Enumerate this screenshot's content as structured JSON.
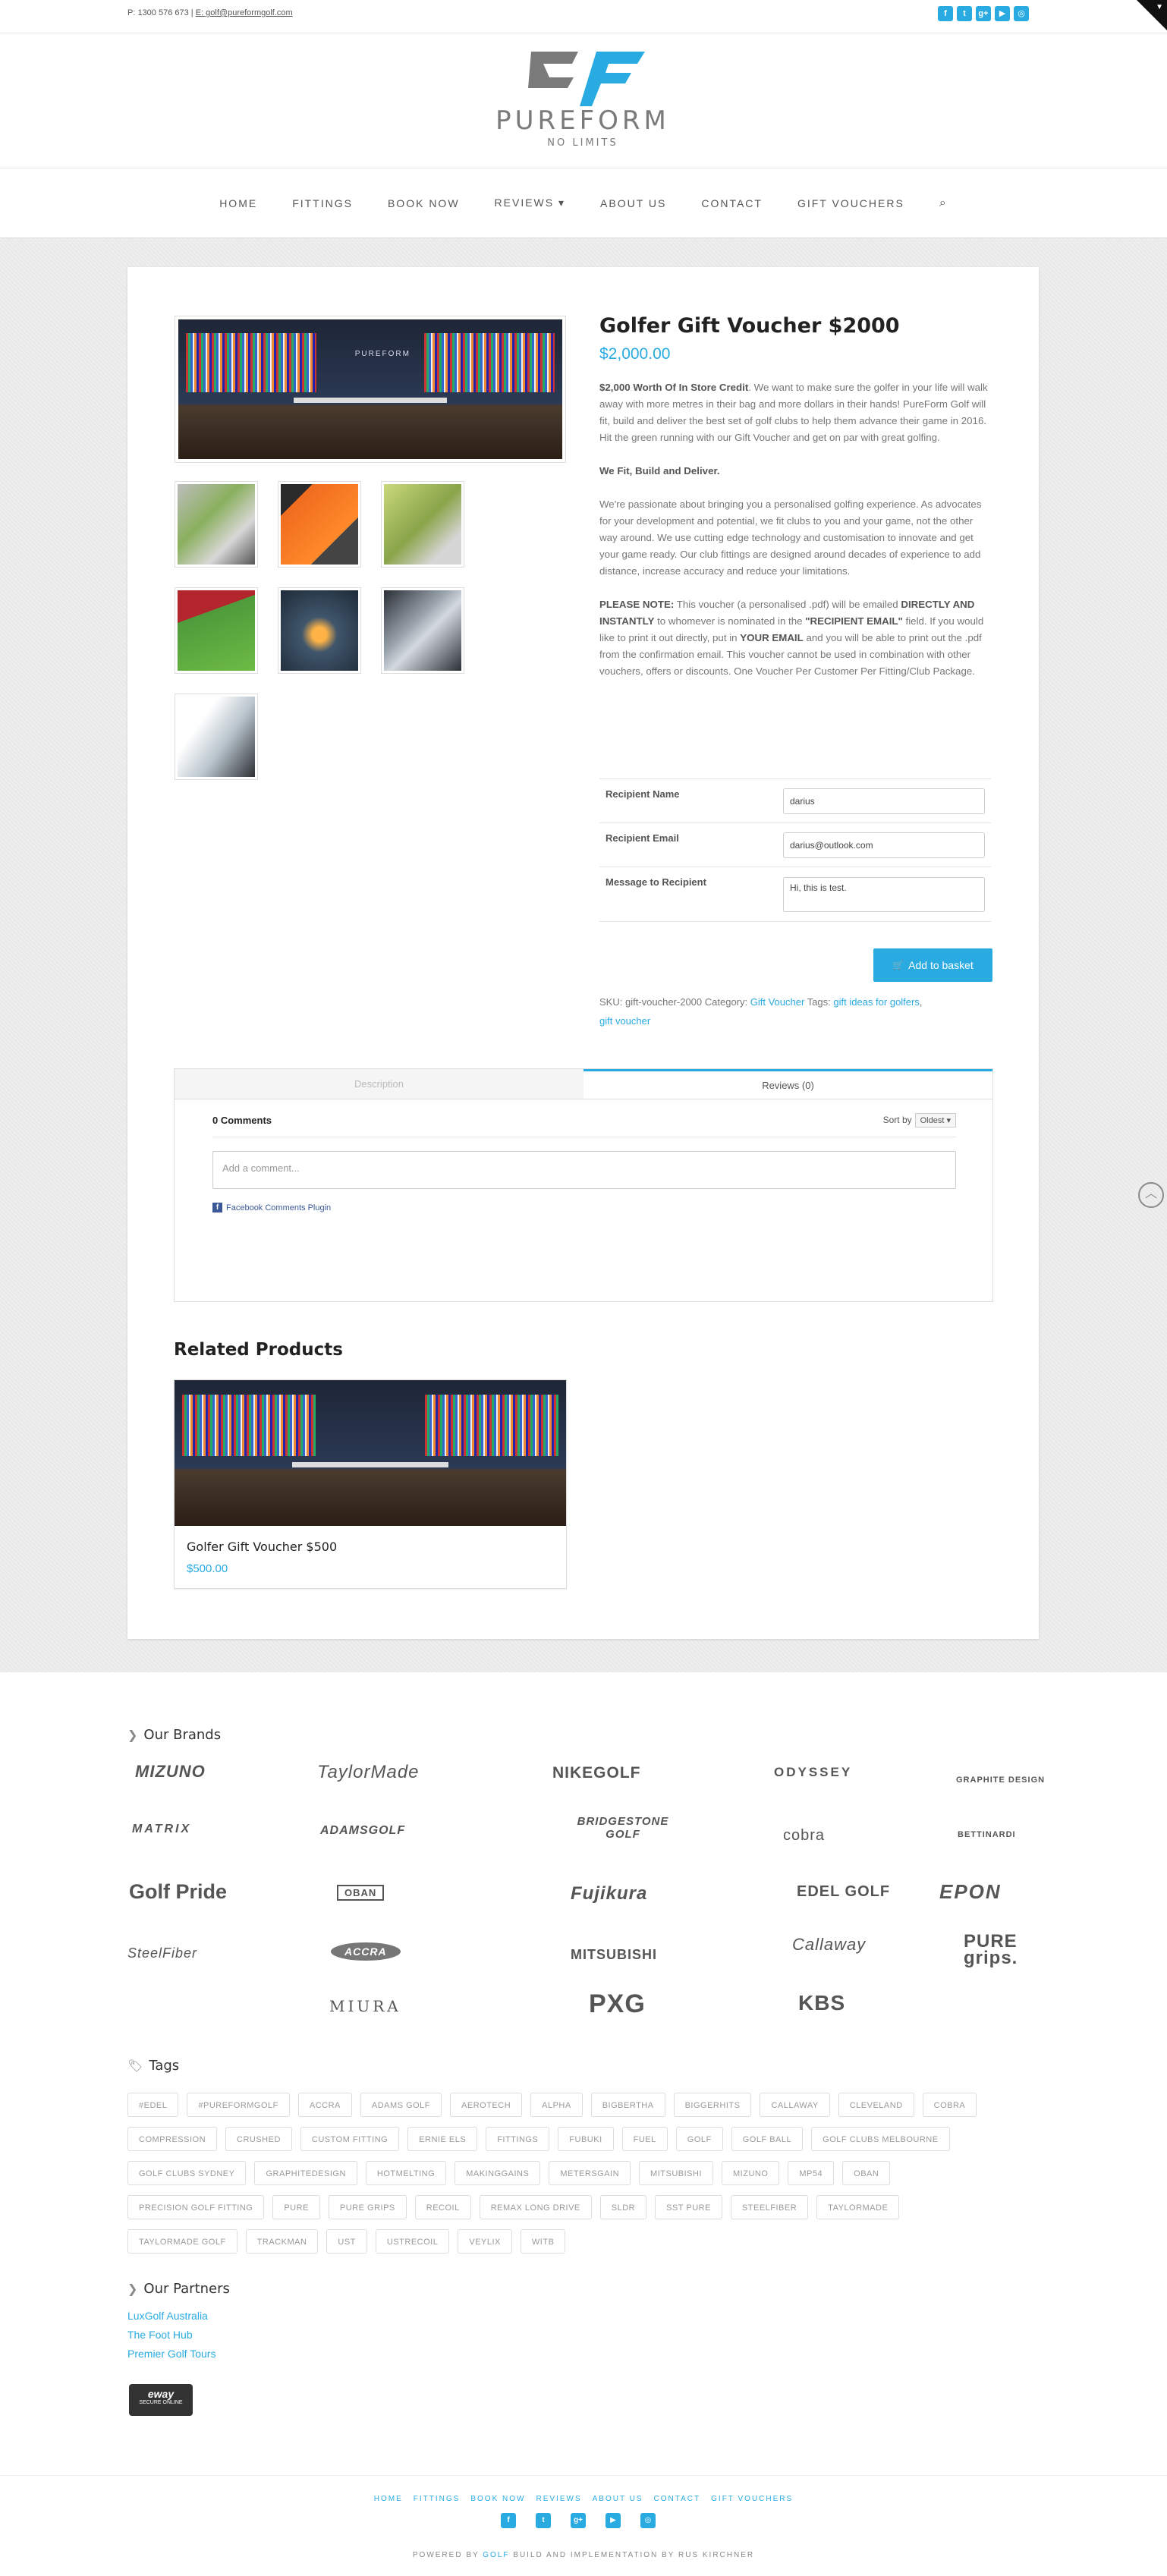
{
  "topbar": {
    "phone_label": "P: 1300 576 673",
    "separator": " | ",
    "email_label": "E: golf@pureformgolf.com",
    "social_icons": [
      "facebook-icon",
      "twitter-icon",
      "google-plus-icon",
      "youtube-icon",
      "instagram-icon"
    ],
    "social_glyphs": [
      "f",
      "t",
      "g+",
      "▶",
      "◎"
    ]
  },
  "logo": {
    "wordmark": "PUREFORM",
    "tagline": "NO LIMITS"
  },
  "nav": {
    "items": [
      "HOME",
      "FITTINGS",
      "BOOK NOW",
      "REVIEWS ▾",
      "ABOUT US",
      "CONTACT",
      "GIFT VOUCHERS"
    ],
    "search_glyph": "⌕"
  },
  "product": {
    "title": "Golfer Gift Voucher $2000",
    "price": "$2,000.00",
    "image_brand": "PUREFORM",
    "desc_p1_bold": "$2,000 Worth Of In Store Credit",
    "desc_p1_rest": ". We want to make sure the golfer in your life will walk away with more metres in their bag and more dollars in their hands! PureForm Golf will fit, build and deliver the best set of golf clubs to help them advance their game in 2016. Hit the green running with our Gift Voucher and get on par with great golfing.",
    "desc_p2": "We Fit, Build and Deliver.",
    "desc_p3": "We're passionate about bringing you a personalised golfing experience. As advocates for your development and potential, we fit clubs to you and your game, not the other way around. We use cutting edge technology and customisation to innovate and get your game ready. Our club fittings are designed around decades of experience to add distance, increase accuracy and reduce your limitations.",
    "note_label": "PLEASE NOTE:",
    "note_a": " This voucher (a personalised .pdf) will be emailed ",
    "note_b": "DIRECTLY AND INSTANTLY",
    "note_c": " to whomever is nominated in the ",
    "note_d": "\"RECIPIENT EMAIL\"",
    "note_e": " field.  If you would like to print it out directly, put in ",
    "note_f": "YOUR EMAIL",
    "note_g": " and you will be able to print out the .pdf from the confirmation email. This voucher cannot be used in combination with other vouchers, offers or discounts. One Voucher Per Customer Per Fitting/Club Package."
  },
  "form": {
    "recipient_name_label": "Recipient Name",
    "recipient_name_value": "darius",
    "recipient_email_label": "Recipient Email",
    "recipient_email_value": "darius@outlook.com",
    "message_label": "Message to Recipient",
    "message_value": "Hi, this is test.",
    "add_to_basket": "Add to basket",
    "basket_glyph": "🛒"
  },
  "meta": {
    "sku_label": "SKU:",
    "sku": "gift-voucher-2000",
    "category_label": "Category:",
    "category": "Gift Voucher",
    "tags_label": "Tags:",
    "tag1": "gift ideas for golfers",
    "tag_sep": ",",
    "tag2": "gift voucher"
  },
  "tabs": {
    "description": "Description",
    "reviews": "Reviews (0)"
  },
  "comments": {
    "count": "0 Comments",
    "sort_label": "Sort by",
    "sort_value": "Oldest ▾",
    "placeholder": "Add a comment...",
    "plugin_label": "Facebook Comments Plugin"
  },
  "related": {
    "heading": "Related Products",
    "items": [
      {
        "title": "Golfer Gift Voucher $500",
        "price": "$500.00"
      }
    ]
  },
  "brands": {
    "heading": "Our Brands",
    "logos": [
      "MIZUNO",
      "TaylorMade",
      "NIKEGOLF",
      "ODYSSEY",
      "GRAPHITE DESIGN",
      "MATRIX",
      "ADAMSGOLF",
      "BRIDGESTONE GOLF",
      "cobra",
      "BETTINARDI",
      "Golf Pride",
      "OBAN",
      "Fujikura",
      "EDEL GOLF",
      "EPON",
      "SteelFiber",
      "ACCRA",
      "MITSUBISHI",
      "Callaway",
      "PURE grips.",
      "MIURA",
      "PXG",
      "KBS"
    ]
  },
  "tags_section": {
    "heading": "Tags",
    "tags": [
      "#EDEL",
      "#PUREFORMGOLF",
      "ACCRA",
      "ADAMS GOLF",
      "AEROTECH",
      "ALPHA",
      "BIGBERTHA",
      "BIGGERHITS",
      "CALLAWAY",
      "CLEVELAND",
      "COBRA",
      "COMPRESSION",
      "CRUSHED",
      "CUSTOM FITTING",
      "ERNIE ELS",
      "FITTINGS",
      "FUBUKI",
      "FUEL",
      "GOLF",
      "GOLF BALL",
      "GOLF CLUBS MELBOURNE",
      "GOLF CLUBS SYDNEY",
      "GRAPHITEDESIGN",
      "HOTMELTING",
      "MAKINGGAINS",
      "METERSGAIN",
      "MITSUBISHI",
      "MIZUNO",
      "MP54",
      "OBAN",
      "PRECISION GOLF FITTING",
      "PURE",
      "PURE GRIPS",
      "RECOIL",
      "REMAX LONG DRIVE",
      "SLDR",
      "SST PURE",
      "STEELFIBER",
      "TAYLORMADE",
      "TAYLORMADE GOLF",
      "TRACKMAN",
      "UST",
      "USTRECOIL",
      "VEYLIX",
      "WITB"
    ]
  },
  "partners": {
    "heading": "Our Partners",
    "links": [
      "LuxGolf Australia",
      "The Foot Hub",
      "Premier Golf Tours"
    ],
    "eway_label": "eway",
    "eway_sub": "SECURE ONLINE"
  },
  "footer": {
    "nav": [
      "HOME",
      "FITTINGS",
      "BOOK NOW",
      "REVIEWS",
      "ABOUT US",
      "CONTACT",
      "GIFT VOUCHERS"
    ],
    "credit_a": "POWERED BY ",
    "credit_link": "GOLF",
    "credit_b": " BUILD AND IMPLEMENTATION BY RUS KIRCHNER"
  },
  "scroll_glyph": "︿",
  "colors": {
    "accent": "#29abe2",
    "logo_grey": "#7a7a7a",
    "logo_blue": "#29abe2"
  }
}
